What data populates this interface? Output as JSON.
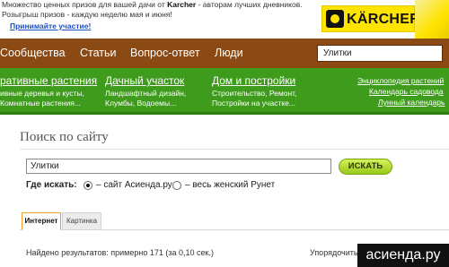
{
  "promo": {
    "line1_pre": "Множество ценных призов для вашей дачи от ",
    "line1_brand": "Karcher",
    "line1_post": " - авторам лучших дневников.",
    "line2": "Розыгрыш призов - каждую неделю мая и июня!",
    "link": "Принимайте участие!",
    "brand_name": "KÄRCHER"
  },
  "topnav": {
    "items": [
      "Сообщества",
      "Статьи",
      "Вопрос-ответ",
      "Люди"
    ],
    "search_value": "Улитки"
  },
  "categories": [
    {
      "title": "ративные растения",
      "sub1": "ивные деревья и кусты,",
      "sub2": "Комнатные растения..."
    },
    {
      "title": "Дачный участок",
      "sub1": "Ландшафтный дизайн,",
      "sub2": "Клумбы, Водоемы..."
    },
    {
      "title": "Дом и постройки",
      "sub1": "Строительство, Ремонт,",
      "sub2": "Постройки на участке..."
    }
  ],
  "right_links": [
    "Энциклопедия растений",
    "Календарь садовода",
    "Лунный календарь"
  ],
  "search": {
    "page_title": "Поиск по сайту",
    "query": "Улитки",
    "button_label": "ИСКАТЬ",
    "where_label": "Где искать:",
    "option_site": "– сайт Асиенда.ру",
    "option_web": "– весь женский Рунет"
  },
  "tabs": [
    "Интернет",
    "Картинка"
  ],
  "results": {
    "summary": "Найдено результатов: примерно 171 (за 0,10 сек.)",
    "sort_label": "Упорядочить"
  },
  "watermark": "асиенда.ру",
  "colors": {
    "topnav": "#8b4a14",
    "catbar": "#3e9b1c",
    "brand_yellow": "#ffe400",
    "button_green": "#99c81b",
    "active_tab": "#f0a020"
  }
}
